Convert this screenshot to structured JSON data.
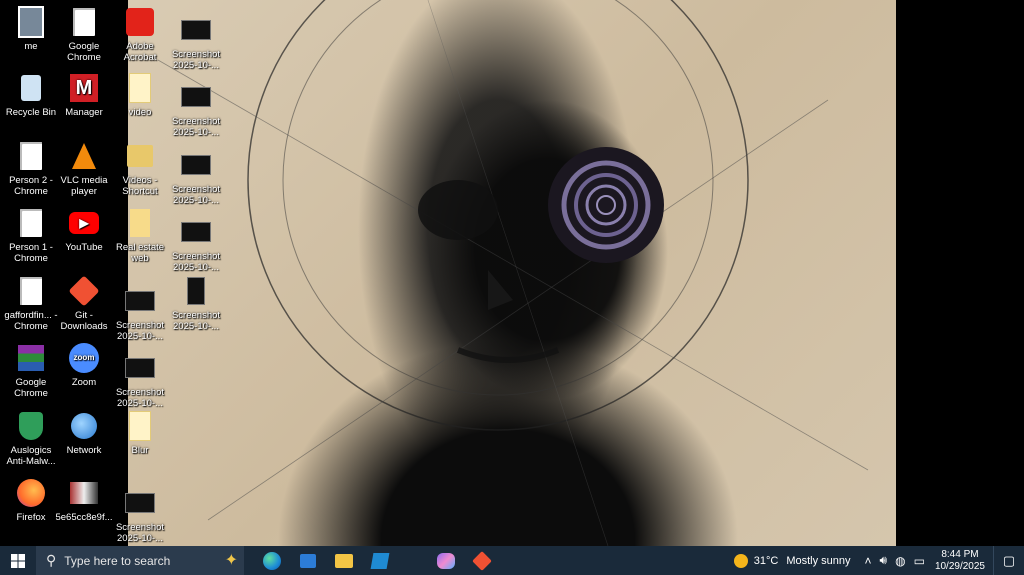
{
  "desktop": {
    "icons": [
      {
        "label": "me"
      },
      {
        "label": "Recycle Bin"
      },
      {
        "label": "Person 2 - Chrome"
      },
      {
        "label": "Person 1 - Chrome"
      },
      {
        "label": "gaffordfin... - Chrome"
      },
      {
        "label": "Google Chrome"
      },
      {
        "label": "Auslogics Anti-Malw..."
      },
      {
        "label": "Firefox"
      },
      {
        "label": "Google Chrome"
      },
      {
        "label": "Manager"
      },
      {
        "label": "VLC media player"
      },
      {
        "label": "YouTube"
      },
      {
        "label": "Git - Downloads"
      },
      {
        "label": "Zoom"
      },
      {
        "label": "Network"
      },
      {
        "label": "5e65cc8e9f..."
      },
      {
        "label": "Adobe Acrobat"
      },
      {
        "label": "video"
      },
      {
        "label": "Videos - Shortcut"
      },
      {
        "label": "Real estate web"
      },
      {
        "label": "Screenshot 2025-10-..."
      },
      {
        "label": "Screenshot 2025-10-..."
      },
      {
        "label": "Blur"
      },
      {
        "label": "Screenshot 2025-10-..."
      },
      {
        "label": "Screenshot 2025-10-..."
      },
      {
        "label": "Screenshot 2025-10-..."
      },
      {
        "label": "Screenshot 2025-10-..."
      },
      {
        "label": "Screenshot 2025-10-..."
      },
      {
        "label": "Screenshot 2025-10-..."
      }
    ]
  },
  "taskbar": {
    "search_placeholder": "Type here to search",
    "apps": [
      "edge-icon",
      "store-icon",
      "file-explorer-icon",
      "vscode-icon",
      "copilot-icon",
      "git-icon"
    ],
    "weather": {
      "temp": "31°C",
      "condition": "Mostly sunny"
    },
    "clock": {
      "time": "8:44 PM",
      "date": "10/29/2025"
    }
  },
  "colors": {
    "taskbar_bg": "#1a2a3a",
    "search_bg": "#2b3b4d",
    "accent": "#0078d4"
  }
}
